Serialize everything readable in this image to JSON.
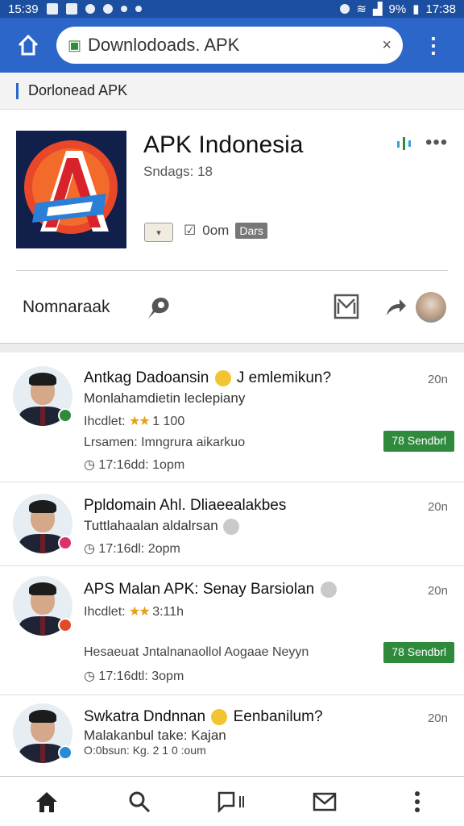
{
  "statusbar": {
    "time_left": "15:39",
    "battery": "9%",
    "time_right": "17:38"
  },
  "browser": {
    "url": "Downlodoads. APK",
    "close": "×",
    "menu": "⋮"
  },
  "breadcrumb": {
    "label": "Dorlonead APK"
  },
  "app": {
    "title": "APK Indonesia",
    "subtitle": "Sndags: 18",
    "meta_text": "0om",
    "meta_badge": "Dars",
    "more": "•••",
    "action_label": "Nomnaraak"
  },
  "feed": [
    {
      "title": "Antkag Dadoansin",
      "title_suffix": "J emlemikun?",
      "line": "Monlahamdietin leclepiany",
      "rating_prefix": "Ihcdlet:",
      "rating_value": "1 100",
      "meta2": "Lrsamen: Imngrura aikarkuo",
      "timestamp": "17:16dd: 1opm",
      "time": "20n",
      "tag": "78 Sendbrl",
      "badge_color": "#2f8a3c"
    },
    {
      "title": "Ppldomain Ahl. Dliaeealakbes",
      "line": "Tuttlahaalan aldalrsan",
      "timestamp": "17:16dl: 2opm",
      "time": "20n",
      "badge_color": "#d8336a"
    },
    {
      "title": "APS Malan APK: Senay Barsiolan",
      "rating_prefix": "Ihcdlet:",
      "rating_value": "3:11h",
      "meta2": "Hesaeuat Jntalnanaollol Aogaae Neyyn",
      "timestamp": "17:16dtl: 3opm",
      "time": "20n",
      "tag": "78 Sendbrl",
      "badge_color": "#e24a2a"
    },
    {
      "title": "Swkatra Dndnnan",
      "title_suffix": "Eenbanilum?",
      "line": "Malakanbul take: Kajan",
      "timestamp": "O:0bsun: Kg. 2 1 0 :oum",
      "time": "20n",
      "badge_color": "#2a8ad4"
    }
  ],
  "colors": {
    "brand_blue": "#2c66c9",
    "status_blue": "#1d4fa0",
    "tag_green": "#2f8a3c"
  }
}
